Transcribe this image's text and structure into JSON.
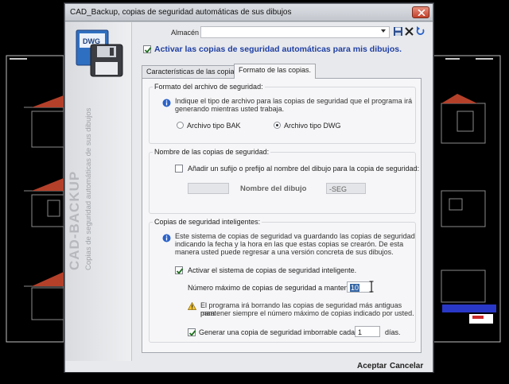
{
  "window": {
    "title": "CAD_Backup, copias de seguridad automáticas de sus dibujos"
  },
  "banner": {
    "logo_text": "DWG",
    "brand": "CAD-BACKUP",
    "subtitle": "Copias de seguridad automáticas de sus dibujos"
  },
  "header": {
    "almacen_label": "Almacén",
    "almacen_value": "",
    "activate_label": "Activar las copias de seguridad automáticas para mis dibujos.",
    "activate_checked": true
  },
  "tabs": [
    {
      "label": "Características de las copias."
    },
    {
      "label": "Formato de las copias."
    }
  ],
  "format_group": {
    "title": "Formato del archivo de seguridad:",
    "info_line1": "Indique el tipo de archivo para las copias de seguridad que el programa irá",
    "info_line2": "generando mientras usted trabaja.",
    "option_bak": "Archivo tipo BAK",
    "option_dwg": "Archivo tipo DWG",
    "selected": "dwg"
  },
  "name_group": {
    "title": "Nombre de las copias de seguridad:",
    "suffix_label": "Añadir un sufijo o prefijo al nombre del dibujo para la copia de seguridad:",
    "suffix_checked": false,
    "prefix_value": "",
    "middle_label": "Nombre del dibujo",
    "suffix_value": "-SEG"
  },
  "smart_group": {
    "title": "Copias de seguridad inteligentes:",
    "info_line1": "Este sistema de copias de seguridad va guardando las copias de seguridad",
    "info_line2": "indicando la fecha y la hora en las que estas copias se crearón. De esta",
    "info_line3": "manera usted puede regresar a una versión concreta de sus dibujos.",
    "activate_label": "Activar el sistema de copias de seguridad inteligente.",
    "activate_checked": true,
    "max_label": "Número máximo de copias de seguridad a mantener:",
    "max_value": "10",
    "warn_line1": "El programa irá borrando las copias de seguridad más antiguas para",
    "warn_line2": "mantener siempre el número máximo de copias indicado por usted.",
    "indelible_label": "Generar una copia de seguridad imborrable cada:",
    "indelible_checked": true,
    "indelible_value": "1",
    "indelible_unit": "días."
  },
  "footer": {
    "accept_label": "Aceptar",
    "cancel_label": "Cancelar"
  }
}
